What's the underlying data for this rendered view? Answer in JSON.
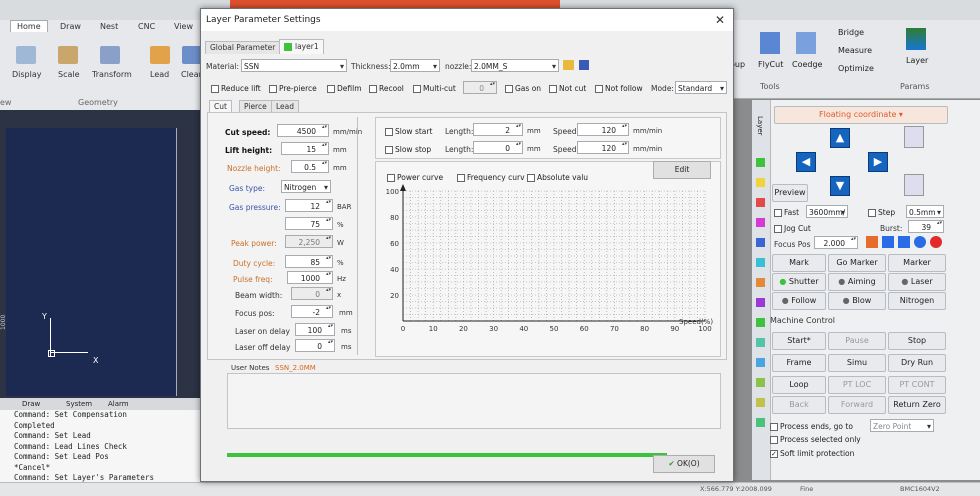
{
  "app": {
    "tabs": [
      "Home",
      "Draw",
      "Nest",
      "CNC",
      "View"
    ],
    "ribbon_buttons": [
      "Display",
      "Scale",
      "Transform",
      "Lead",
      "Clear"
    ],
    "ribbon_group": "Geometry",
    "ribbon_group_left": "ew",
    "bottom_tabs": [
      "Draw",
      "System",
      "Alarm"
    ],
    "console_lines": [
      "Command: Set Compensation",
      "Completed",
      "Command: Set Lead",
      "Command: Lead Lines Check",
      "Command: Set Lead Pos",
      "*Cancel*",
      "Command: Set Layer's Parameters"
    ],
    "axis_y": "Y",
    "axis_x": "X",
    "ruler_value": "1000"
  },
  "right_ribbon": {
    "flycut": "FlyCut",
    "coedge": "Coedge",
    "bridge": "Bridge",
    "measure": "Measure",
    "optimize": "Optimize",
    "layer": "Layer",
    "group_tools": "Tools",
    "group_params": "Params",
    "cut_label": "oup"
  },
  "right_panel": {
    "side_tab": "Layer",
    "coord_mode": "Floating coordinate",
    "preview": "Preview",
    "fast_label": "Fast",
    "fast_value": "3600mm/",
    "step_label": "Step",
    "step_value": "0.5mm",
    "jog_label": "Jog Cut",
    "burst_label": "Burst:",
    "burst_value": "39",
    "focus_label": "Focus Pos",
    "focus_value": "2.000",
    "mark": "Mark",
    "go_marker": "Go Marker",
    "marker": "Marker",
    "shutter": "Shutter",
    "aiming": "Aiming",
    "laser": "Laser",
    "follow": "Follow",
    "blow": "Blow",
    "nitrogen": "Nitrogen",
    "machine_control": "Machine Control",
    "start": "Start*",
    "pause": "Pause",
    "stop": "Stop",
    "frame": "Frame",
    "simu": "Simu",
    "dry_run": "Dry Run",
    "loop": "Loop",
    "pt_loc": "PT LOC",
    "pt_cont": "PT CONT",
    "back": "Back",
    "forward": "Forward",
    "return_zero": "Return Zero",
    "process_ends": "Process ends, go to",
    "process_ends_value": "Zero Point",
    "process_selected": "Process selected only",
    "soft_limit": "Soft limit protection"
  },
  "status_bar": {
    "coords": "X:566.779 Y:2008.099",
    "fine": "Fine",
    "controller": "BMC1604V2"
  },
  "dialog": {
    "title": "Layer Parameter Settings",
    "tabs": [
      "Global Parameter",
      "layer1"
    ],
    "material_label": "Material:",
    "material_value": "SSN",
    "thickness_label": "Thickness:",
    "thickness_value": "2.0mm",
    "nozzle_label": "nozzle:",
    "nozzle_value": "2.0MM_S",
    "options": {
      "reduce_lift": "Reduce lift",
      "pre_pierce": "Pre-pierce",
      "defilm": "Defilm",
      "recool": "Recool",
      "multi_cut": "Multi-cut",
      "multi_cut_value": "0",
      "gas_on": "Gas on",
      "not_cut": "Not cut",
      "not_follow": "Not follow",
      "mode_label": "Mode:",
      "mode_value": "Standard"
    },
    "subtabs": [
      "Cut",
      "Pierce",
      "Lead"
    ],
    "params": [
      {
        "label": "Cut speed:",
        "value": "4500",
        "unit": "mm/min"
      },
      {
        "label": "Lift height:",
        "value": "15",
        "unit": "mm"
      },
      {
        "label": "Nozzle height:",
        "value": "0.5",
        "unit": "mm"
      },
      {
        "label": "Gas type:",
        "value": "Nitrogen",
        "unit": ""
      },
      {
        "label": "Gas pressure:",
        "value": "12",
        "unit": "BAR"
      },
      {
        "label": "",
        "value": "75",
        "unit": "%"
      },
      {
        "label": "Peak power:",
        "value": "2,250",
        "unit": "W"
      },
      {
        "label": "Duty cycle:",
        "value": "85",
        "unit": "%"
      },
      {
        "label": "Pulse freq:",
        "value": "1000",
        "unit": "Hz"
      },
      {
        "label": "Beam width:",
        "value": "0",
        "unit": "x"
      },
      {
        "label": "Focus pos:",
        "value": "-2",
        "unit": "mm"
      },
      {
        "label": "Laser on delay",
        "value": "100",
        "unit": "ms"
      },
      {
        "label": "Laser off delay",
        "value": "0",
        "unit": "ms"
      }
    ],
    "slow_start": {
      "label": "Slow start",
      "length_label": "Length:",
      "length": "2",
      "length_unit": "mm",
      "speed_label": "Speed:",
      "speed": "120",
      "speed_unit": "mm/min"
    },
    "slow_stop": {
      "label": "Slow stop",
      "length_label": "Length:",
      "length": "0",
      "length_unit": "mm",
      "speed_label": "Speed:",
      "speed": "120",
      "speed_unit": "mm/min"
    },
    "power_curve": "Power curve",
    "frequency_curve": "Frequency curv",
    "absolute_value": "Absolute valu",
    "edit_button": "Edit",
    "chart_xlabel": "Speed(%)",
    "user_notes_label": "User Notes",
    "user_notes_value": "SSN_2.0MM",
    "ok_button": "OK(O)"
  },
  "chart_data": {
    "type": "line",
    "xlabel": "Speed(%)",
    "ylabel": "",
    "x_ticks": [
      "0",
      "10",
      "20",
      "30",
      "40",
      "50",
      "60",
      "70",
      "80",
      "90",
      "100"
    ],
    "y_ticks": [
      "20",
      "40",
      "60",
      "80",
      "100"
    ],
    "xlim": [
      0,
      100
    ],
    "ylim": [
      0,
      100
    ],
    "grid": true,
    "series": []
  },
  "colors": {
    "accent": "#1565c0",
    "layer_green": "#3cc23c",
    "orange_label": "#c8702a",
    "blue_label": "#3755a8",
    "ribbon_red": "#e0512d"
  }
}
